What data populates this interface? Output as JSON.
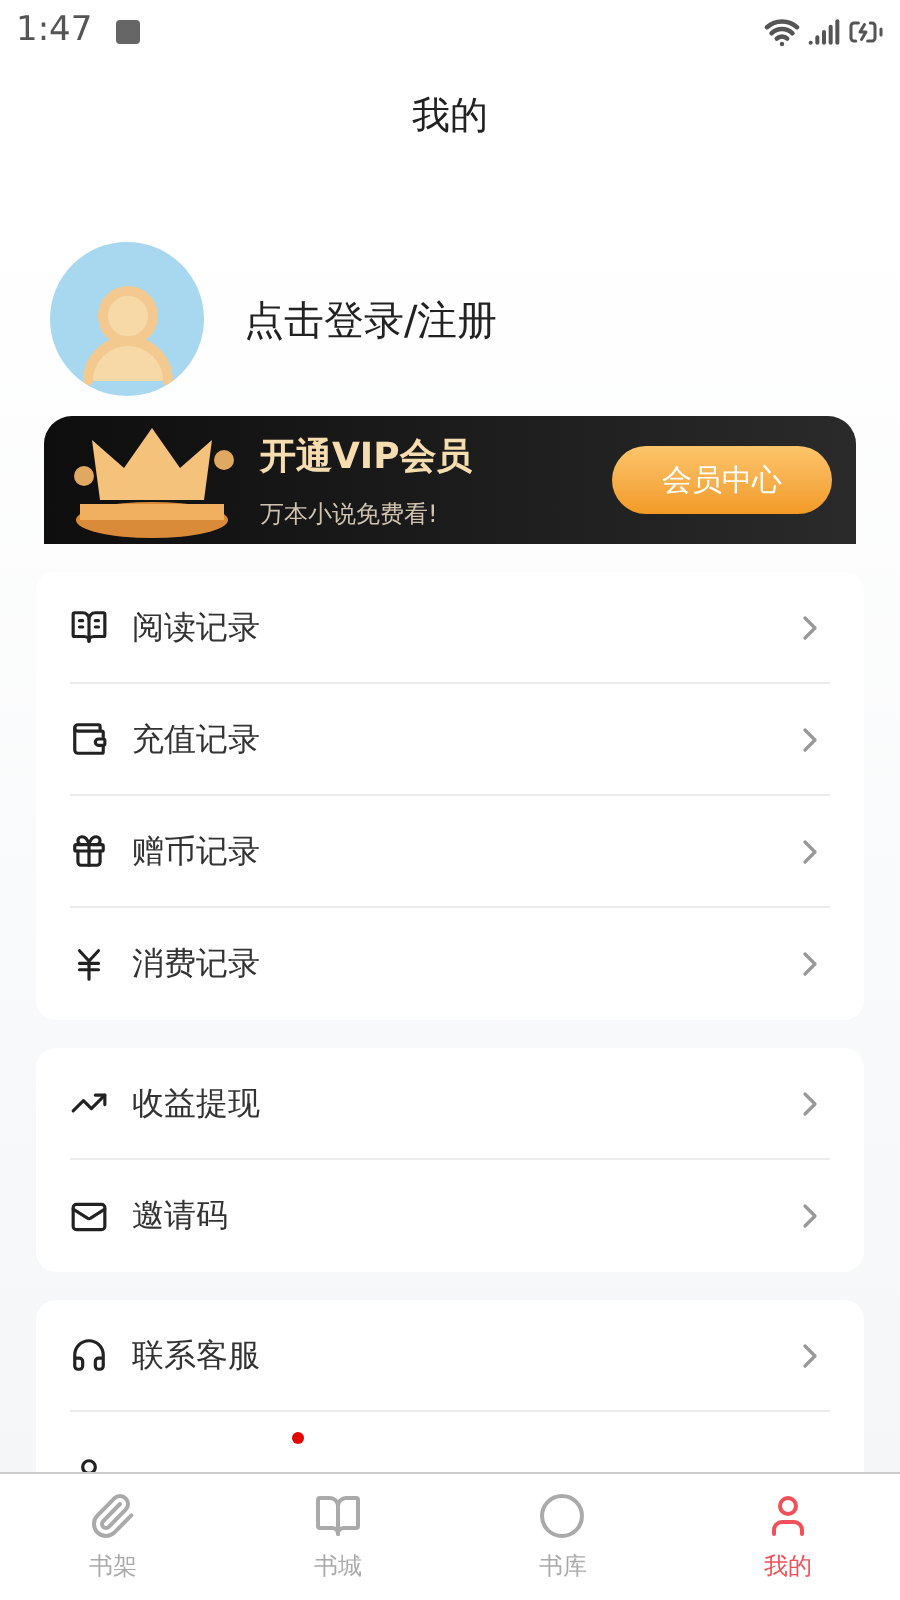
{
  "status_bar": {
    "time": "1:47"
  },
  "header": {
    "title": "我的"
  },
  "profile": {
    "login_text": "点击登录/注册"
  },
  "vip_banner": {
    "title": "开通VIP会员",
    "subtitle": "万本小说免费看!",
    "button": "会员中心"
  },
  "cards": [
    {
      "items": [
        {
          "label": "阅读记录"
        },
        {
          "label": "充值记录"
        },
        {
          "label": "赠币记录"
        },
        {
          "label": "消费记录"
        }
      ]
    },
    {
      "items": [
        {
          "label": "收益提现"
        },
        {
          "label": "邀请码"
        }
      ]
    },
    {
      "items": [
        {
          "label": "联系客服"
        }
      ],
      "partial_item": {
        "dot": true
      }
    }
  ],
  "tabs": [
    {
      "label": "书架",
      "selected": false
    },
    {
      "label": "书城",
      "selected": false
    },
    {
      "label": "书库",
      "selected": false
    },
    {
      "label": "我的",
      "selected": true
    }
  ]
}
